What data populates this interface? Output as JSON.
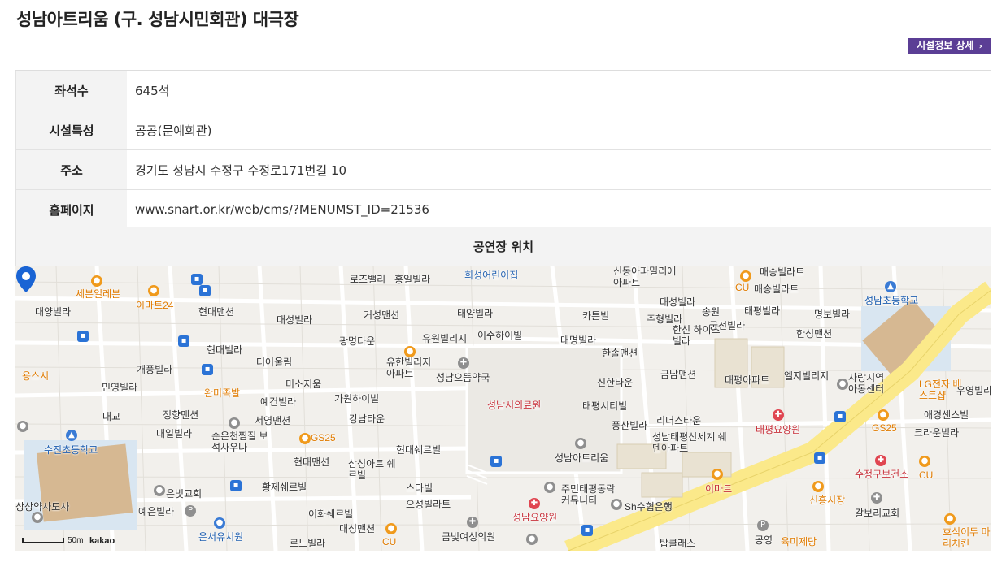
{
  "page": {
    "title": "성남아트리움 (구. 성남시민회관) 대극장",
    "detail_button": "시설정보 상세",
    "detail_chevron": "›"
  },
  "info": {
    "rows": [
      {
        "label": "좌석수",
        "value": "645석"
      },
      {
        "label": "시설특성",
        "value": "공공(문예회관)"
      },
      {
        "label": "주소",
        "value": "경기도 성남시 수정구 수정로171번길 10"
      },
      {
        "label": "홈페이지",
        "value": "www.snart.or.kr/web/cms/?MENUMST_ID=21536"
      }
    ]
  },
  "location": {
    "header": "공연장 위치"
  },
  "map": {
    "labels": [
      "세븐일레븐",
      "이마트24",
      "현대맨션",
      "대양빌라",
      "대성빌라",
      "거성맨션",
      "태양빌라",
      "카튼빌",
      "태성빌라",
      "송원",
      "태평빌라",
      "명보빌라",
      "성남초등학교",
      "현대빌라",
      "광명타운",
      "유원빌리지",
      "이수하이빌",
      "대명빌라",
      "한솔맨션",
      "주형빌라",
      "한신 하이츠빌라",
      "궁전빌라",
      "한성맨션",
      "개풍빌라",
      "더어울림",
      "유한빌리지 아파트",
      "성남으뜸약국",
      "금남맨션",
      "태평아파트",
      "엘지빌리지",
      "사랑지역 아동센터",
      "LG전자 베스트샵",
      "우영빌라",
      "용스시",
      "민영빌라",
      "미소지움",
      "완미족발",
      "예건빌라",
      "가원하이빌",
      "성남시의료원",
      "신한타운",
      "태평시티빌",
      "리더스타운",
      "정향맨션",
      "서영맨션",
      "강남타운",
      "풍산빌라",
      "대교",
      "수진초등학교",
      "대일빌라",
      "순은천찜질 보석사우나",
      "GS25",
      "현대쉐르빌",
      "성남아트리움",
      "성남태평신세계 쉐덴아파트",
      "태평요양원",
      "GS25",
      "애경센스빌",
      "크라운빌라",
      "현대맨션",
      "삼성아트 쉐르빌",
      "이마트",
      "수정구보건소",
      "CU",
      "은빛교회",
      "황제쉐르빌",
      "스타빌",
      "주민태평동락 커뮤니티",
      "으성빌라트",
      "Sh수협은행",
      "신흥시장",
      "갈보리교회",
      "예은빌라",
      "이화쉐르빌",
      "성남요양원",
      "은서유치원",
      "대성맨션",
      "CU",
      "금빛여성의원",
      "공영",
      "육미제당",
      "호식이두 마리치킨",
      "르노빌라",
      "탑클래스",
      "희성어린이집",
      "로즈밸리",
      "홍일빌라",
      "신동아파밀리에 아파트",
      "매송빌라트",
      "매송빌라트",
      "CU",
      "상상약사도사"
    ],
    "scale": "50m",
    "brand": "kakao",
    "marker_label": "성남시의료원"
  },
  "colors": {
    "accent": "#5b3e95",
    "header_bg": "#f3f3f3",
    "road_yellow": "#fbe98a",
    "park_green": "#cfe8c4",
    "pin_blue": "#1a64d4"
  }
}
